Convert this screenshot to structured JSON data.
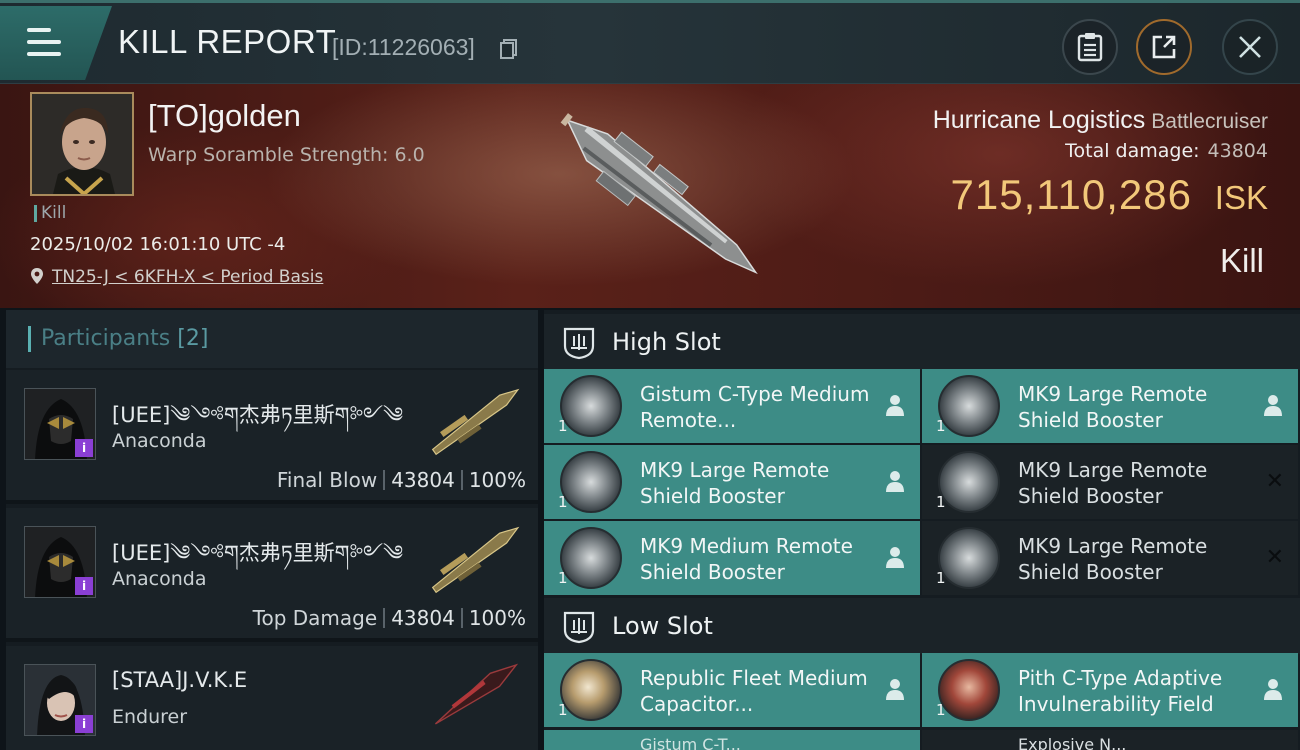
{
  "header": {
    "title": "KILL REPORT",
    "report_id": "[ID:11226063]"
  },
  "victim": {
    "pilot_name": "[TO]golden",
    "scramble": "Warp Soramble Strength: 6.0",
    "tag": "Kill",
    "datetime": "2025/10/02 16:01:10 UTC -4",
    "location": "TN25-J < 6KFH-X < Period Basis",
    "ship_name": "Hurricane Logistics",
    "ship_class": "Battlecruiser",
    "total_damage_label": "Total damage:",
    "total_damage": "43804",
    "isk_value": "715,110,286",
    "isk_unit": "ISK",
    "result": "Kill"
  },
  "participants": {
    "title": "Participants",
    "count": "[2]",
    "rows": [
      {
        "name": "[UEE]༄༺ག杰弗ཏ里斯ག༻༄",
        "ship": "Anaconda",
        "role": "Final Blow",
        "damage": "43804",
        "percent": "100%"
      },
      {
        "name": "[UEE]༄༺ག杰弗ཏ里斯ག༻༄",
        "ship": "Anaconda",
        "role": "Top Damage",
        "damage": "43804",
        "percent": "100%"
      },
      {
        "name": "[STAA]J.V.K.E",
        "ship": "Endurer",
        "role": "",
        "damage": "",
        "percent": ""
      }
    ]
  },
  "fitting": {
    "high_slot_title": "High Slot",
    "low_slot_title": "Low Slot",
    "high_slot": [
      {
        "qty": "1",
        "name": "Gistum C-Type Medium Remote...",
        "status": "person-icon"
      },
      {
        "qty": "1",
        "name": "MK9 Large Remote Shield Booster",
        "status": "person-icon"
      },
      {
        "qty": "1",
        "name": "MK9 Large Remote Shield Booster",
        "status": "person-icon"
      },
      {
        "qty": "1",
        "name": "MK9 Large Remote Shield Booster",
        "status": "destroyed-icon"
      },
      {
        "qty": "1",
        "name": "MK9 Medium Remote Shield Booster",
        "status": "person-icon"
      },
      {
        "qty": "1",
        "name": "MK9 Large Remote Shield Booster",
        "status": "destroyed-icon"
      }
    ],
    "low_slot": [
      {
        "qty": "1",
        "name": "Republic Fleet Medium Capacitor...",
        "status": "person-icon"
      },
      {
        "qty": "1",
        "name": "Pith C-Type Adaptive Invulnerability Field",
        "status": "person-icon"
      }
    ],
    "low_slot_partial": [
      "Gistum C-T...",
      "Explosive N..."
    ]
  },
  "colors": {
    "accent_teal": "#3d8c86",
    "isk_gold": "#f2c87a",
    "hero_red": "#5a2119",
    "corp_badge": "#8a3fd4"
  }
}
